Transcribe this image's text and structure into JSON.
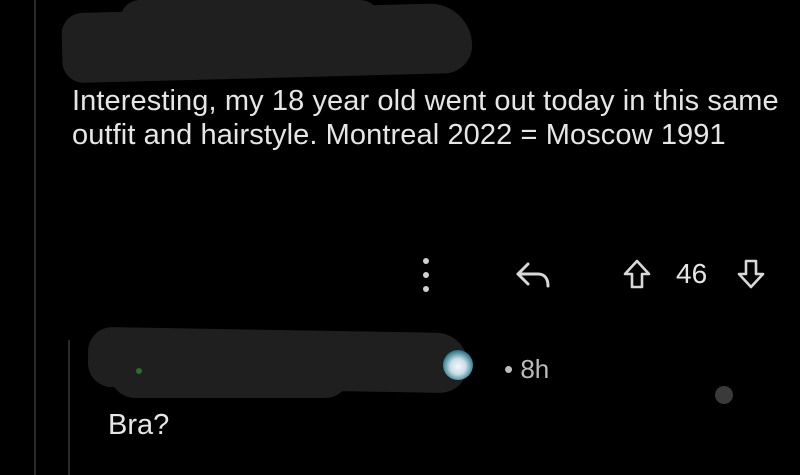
{
  "comment": {
    "author_redacted": true,
    "body": "Interesting, my 18 year old went out today in this same outfit and hairstyle. Montreal 2022 = Moscow 1991",
    "vote_count": "46",
    "icons": {
      "more": "more-vertical-icon",
      "reply": "reply-arrow-icon",
      "upvote": "upvote-arrow-icon",
      "downvote": "downvote-arrow-icon"
    }
  },
  "reply": {
    "author_redacted": true,
    "timestamp": "• 8h",
    "body": "Bra?",
    "avatar_icon": "snoo-avatar-icon"
  },
  "colors": {
    "background": "#000000",
    "text": "#e6e6e6",
    "muted_text": "#bcbcbc",
    "thread_line": "#2a2a2a"
  }
}
